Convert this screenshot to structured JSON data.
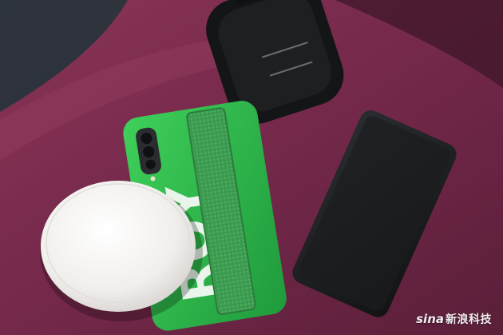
{
  "photo": {
    "case_print": "ROY",
    "watermark_logo": "sina",
    "watermark_text": "新浪科技"
  },
  "colors": {
    "sofa": "#7a2a4a",
    "case_green": "#2cb84c",
    "strap_green": "#3a9a4e",
    "pad_white": "#f2f0ee",
    "power_bank": "#1c1e20",
    "charger": "#151617"
  },
  "icons": [
    "camera-lens-icon",
    "flash-icon"
  ]
}
